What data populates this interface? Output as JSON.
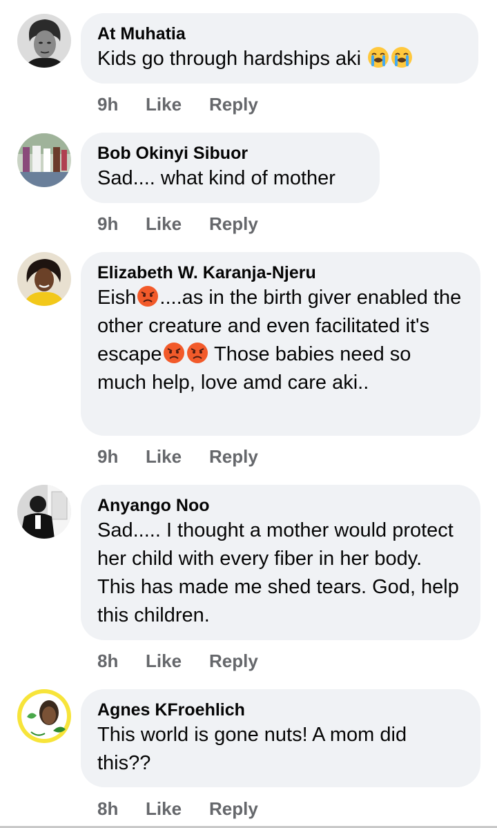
{
  "comments": [
    {
      "author": "At Muhatia",
      "text_before": "Kids go through hardships aki ",
      "emoji": [
        "loudly-crying-face",
        "loudly-crying-face"
      ],
      "time": "9h",
      "like": "Like",
      "reply": "Reply"
    },
    {
      "author": "Bob Okinyi Sibuor",
      "text": "Sad.... what kind of mother",
      "time": "9h",
      "like": "Like",
      "reply": "Reply"
    },
    {
      "author": "Elizabeth W. Karanja-Njeru",
      "text_part1": "Eish",
      "text_part2": "....as in the birth giver enabled the other creature and even facilitated it's escape",
      "text_part3": " Those babies need so much help, love amd care aki..",
      "emoji": [
        "pouting-face",
        "pouting-face",
        "pouting-face"
      ],
      "time": "9h",
      "like": "Like",
      "reply": "Reply"
    },
    {
      "author": "Anyango Noo",
      "text": "Sad..... I thought a mother would protect her child with every fiber in her body. This has made me shed tears. God, help this children.",
      "time": "8h",
      "like": "Like",
      "reply": "Reply"
    },
    {
      "author": "Agnes KFroehlich",
      "text": "This world is gone nuts! A mom did this??",
      "time": "8h",
      "like": "Like",
      "reply": "Reply"
    }
  ],
  "colors": {
    "bubble": "#f0f2f5",
    "meta": "#65676b",
    "text": "#050505"
  }
}
